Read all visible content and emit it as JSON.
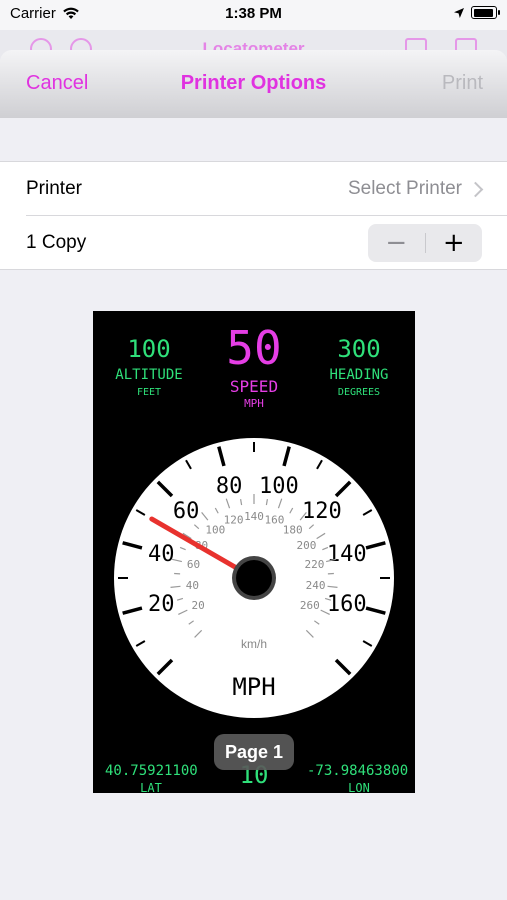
{
  "status_bar": {
    "carrier": "Carrier",
    "time": "1:38 PM"
  },
  "app_title": "Locatometer",
  "nav": {
    "cancel": "Cancel",
    "title": "Printer Options",
    "print": "Print"
  },
  "printer_row": {
    "label": "Printer",
    "value": "Select Printer"
  },
  "copies_row": {
    "label": "1 Copy",
    "decrement": "−",
    "increment": "+"
  },
  "preview": {
    "page_label": "Page 1",
    "altitude": {
      "value": "100",
      "label": "ALTITUDE",
      "unit": "FEET"
    },
    "speed": {
      "value": "50",
      "label": "SPEED",
      "unit": "MPH"
    },
    "heading": {
      "value": "300",
      "label": "HEADING",
      "unit": "DEGREES"
    },
    "gauge_mph_ticks": [
      "20",
      "40",
      "60",
      "80",
      "100",
      "120",
      "140",
      "160"
    ],
    "gauge_kmh_ticks": [
      "20",
      "40",
      "60",
      "80",
      "100",
      "120",
      "140",
      "160",
      "180",
      "200",
      "220",
      "240",
      "260"
    ],
    "gauge_kmh_unit": "km/h",
    "gauge_unit": "MPH",
    "needle_mph": 50,
    "lat": {
      "value": "40.75921100",
      "label": "LAT"
    },
    "lon": {
      "value": "-73.98463800",
      "label": "LON"
    },
    "bottom_center_value": "10"
  },
  "colors": {
    "accent": "#e032e0",
    "digital_green": "#2fe07a",
    "digital_magenta": "#e53ee5",
    "needle": "#e8322e"
  }
}
